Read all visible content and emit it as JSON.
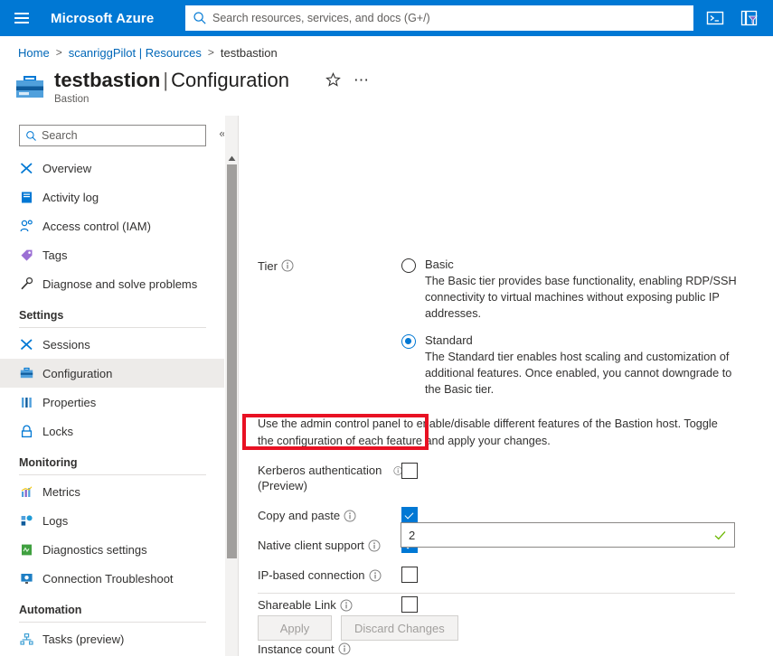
{
  "topbar": {
    "menu_icon": "hamburger-icon",
    "brand": "Microsoft Azure",
    "search_placeholder": "Search resources, services, and docs (G+/)",
    "search_icon": "search-icon",
    "cloudshell_icon": "cloud-shell-icon",
    "directories_icon": "directories-subscriptions-filter-icon"
  },
  "breadcrumb": {
    "items": [
      {
        "label": "Home",
        "link": true
      },
      {
        "label": "scanriggPilot | Resources",
        "link": true
      },
      {
        "label": "testbastion",
        "link": false
      }
    ],
    "separator": ">"
  },
  "header": {
    "resource_icon": "bastion-resource-icon",
    "resource_name": "testbastion",
    "separator": "|",
    "page_name": "Configuration",
    "subtitle": "Bastion",
    "favorite_icon": "star-icon",
    "more_icon": "ellipsis-icon"
  },
  "sidebar": {
    "search_placeholder": "Search",
    "search_icon": "search-icon",
    "collapse_icon": "chevron-double-left-icon",
    "items": [
      {
        "label": "Overview",
        "icon": "overview-icon",
        "selected": false
      },
      {
        "label": "Activity log",
        "icon": "activity-log-icon",
        "selected": false
      },
      {
        "label": "Access control (IAM)",
        "icon": "access-control-icon",
        "selected": false
      },
      {
        "label": "Tags",
        "icon": "tags-icon",
        "selected": false
      },
      {
        "label": "Diagnose and solve problems",
        "icon": "diagnose-icon",
        "selected": false
      }
    ],
    "groups": [
      {
        "title": "Settings",
        "items": [
          {
            "label": "Sessions",
            "icon": "sessions-icon",
            "selected": false
          },
          {
            "label": "Configuration",
            "icon": "configuration-icon",
            "selected": true
          },
          {
            "label": "Properties",
            "icon": "properties-icon",
            "selected": false
          },
          {
            "label": "Locks",
            "icon": "locks-icon",
            "selected": false
          }
        ]
      },
      {
        "title": "Monitoring",
        "items": [
          {
            "label": "Metrics",
            "icon": "metrics-icon",
            "selected": false
          },
          {
            "label": "Logs",
            "icon": "logs-icon",
            "selected": false
          },
          {
            "label": "Diagnostics settings",
            "icon": "diagnostics-settings-icon",
            "selected": false
          },
          {
            "label": "Connection Troubleshoot",
            "icon": "connection-troubleshoot-icon",
            "selected": false
          }
        ]
      },
      {
        "title": "Automation",
        "items": [
          {
            "label": "Tasks (preview)",
            "icon": "tasks-icon",
            "selected": false
          }
        ]
      }
    ]
  },
  "main": {
    "tier": {
      "label": "Tier",
      "info_icon": "info-icon",
      "options": [
        {
          "name": "Basic",
          "description": "The Basic tier provides base functionality, enabling RDP/SSH connectivity to virtual machines without exposing public IP addresses.",
          "selected": false
        },
        {
          "name": "Standard",
          "description": "The Standard tier enables host scaling and customization of additional features. Once enabled, you cannot downgrade to the Basic tier.",
          "selected": true
        }
      ]
    },
    "admin_note": "Use the admin control panel to enable/disable different features of the Bastion host. Toggle the configuration of each feature and apply your changes.",
    "features": [
      {
        "label": "Kerberos authentication (Preview)",
        "info_icon": "info-icon",
        "checked": false,
        "highlighted": false
      },
      {
        "label": "Copy and paste",
        "info_icon": "info-icon",
        "checked": true,
        "highlighted": false
      },
      {
        "label": "Native client support",
        "info_icon": "info-icon",
        "checked": true,
        "highlighted": true
      },
      {
        "label": "IP-based connection",
        "info_icon": "info-icon",
        "checked": false,
        "highlighted": false
      },
      {
        "label": "Shareable Link",
        "info_icon": "info-icon",
        "checked": false,
        "highlighted": false
      }
    ],
    "instance_count": {
      "label": "Instance count",
      "info_icon": "info-icon",
      "value": "2",
      "valid_icon": "green-check-icon"
    },
    "buttons": {
      "apply": "Apply",
      "discard": "Discard Changes"
    }
  },
  "colors": {
    "azure_blue": "#0078d4",
    "link_blue": "#0067b8",
    "highlight_red": "#e81123",
    "valid_green": "#6bb700",
    "selected_nav_bg": "#edebe9"
  }
}
